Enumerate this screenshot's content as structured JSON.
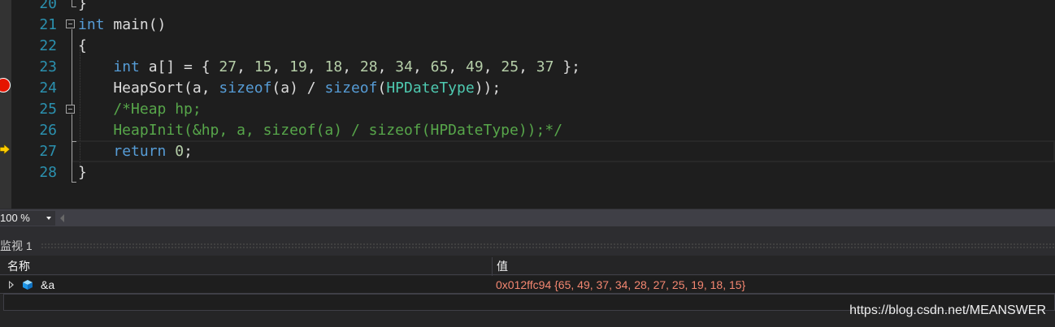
{
  "editor": {
    "line_numbers": [
      "20",
      "21",
      "22",
      "23",
      "24",
      "25",
      "26",
      "27",
      "28"
    ],
    "lines": [
      [
        {
          "t": "}",
          "c": "tx"
        }
      ],
      [
        {
          "t": "int",
          "c": "kw"
        },
        {
          "t": " main()",
          "c": "tx"
        }
      ],
      [
        {
          "t": "{",
          "c": "tx"
        }
      ],
      [
        {
          "t": "    ",
          "c": "tx"
        },
        {
          "t": "int",
          "c": "kw"
        },
        {
          "t": " a[] = { ",
          "c": "tx"
        },
        {
          "t": "27",
          "c": "num"
        },
        {
          "t": ", ",
          "c": "tx"
        },
        {
          "t": "15",
          "c": "num"
        },
        {
          "t": ", ",
          "c": "tx"
        },
        {
          "t": "19",
          "c": "num"
        },
        {
          "t": ", ",
          "c": "tx"
        },
        {
          "t": "18",
          "c": "num"
        },
        {
          "t": ", ",
          "c": "tx"
        },
        {
          "t": "28",
          "c": "num"
        },
        {
          "t": ", ",
          "c": "tx"
        },
        {
          "t": "34",
          "c": "num"
        },
        {
          "t": ", ",
          "c": "tx"
        },
        {
          "t": "65",
          "c": "num"
        },
        {
          "t": ", ",
          "c": "tx"
        },
        {
          "t": "49",
          "c": "num"
        },
        {
          "t": ", ",
          "c": "tx"
        },
        {
          "t": "25",
          "c": "num"
        },
        {
          "t": ", ",
          "c": "tx"
        },
        {
          "t": "37",
          "c": "num"
        },
        {
          "t": " };",
          "c": "tx"
        }
      ],
      [
        {
          "t": "    HeapSort(a, ",
          "c": "tx"
        },
        {
          "t": "sizeof",
          "c": "kw"
        },
        {
          "t": "(a) / ",
          "c": "tx"
        },
        {
          "t": "sizeof",
          "c": "kw"
        },
        {
          "t": "(",
          "c": "tx"
        },
        {
          "t": "HPDateType",
          "c": "ty"
        },
        {
          "t": "));",
          "c": "tx"
        }
      ],
      [
        {
          "t": "    /*Heap hp;",
          "c": "cm"
        }
      ],
      [
        {
          "t": "    HeapInit(&hp, a, sizeof(a) / sizeof(HPDateType));*/",
          "c": "cm"
        }
      ],
      [
        {
          "t": "    ",
          "c": "tx"
        },
        {
          "t": "return",
          "c": "kw"
        },
        {
          "t": " ",
          "c": "tx"
        },
        {
          "t": "0",
          "c": "num"
        },
        {
          "t": ";",
          "c": "tx"
        }
      ],
      [
        {
          "t": "}",
          "c": "tx"
        }
      ]
    ],
    "breakpoint_line": "24",
    "current_line": "27"
  },
  "zoom": {
    "value": "100 %"
  },
  "watch": {
    "title": "监视 1",
    "columns": {
      "name": "名称",
      "value": "值"
    },
    "rows": [
      {
        "name": "&a",
        "value": "0x012ffc94 {65, 49, 37, 34, 28, 27, 25, 19, 18, 15}"
      }
    ]
  },
  "watermark": "https://blog.csdn.net/MEANSWER",
  "colors": {
    "keyword": "#569cd6",
    "type": "#4ec9b0",
    "number": "#b5cea8",
    "comment": "#57a64a",
    "text": "#dcdcdc",
    "line_number": "#2b91af",
    "watch_value": "#f48771",
    "breakpoint": "#e51400"
  },
  "icons": {
    "breakpoint": "breakpoint-icon",
    "instruction_pointer": "instruction-pointer-icon",
    "variable": "variable-cube-icon",
    "expander": "expand-arrow-icon"
  }
}
